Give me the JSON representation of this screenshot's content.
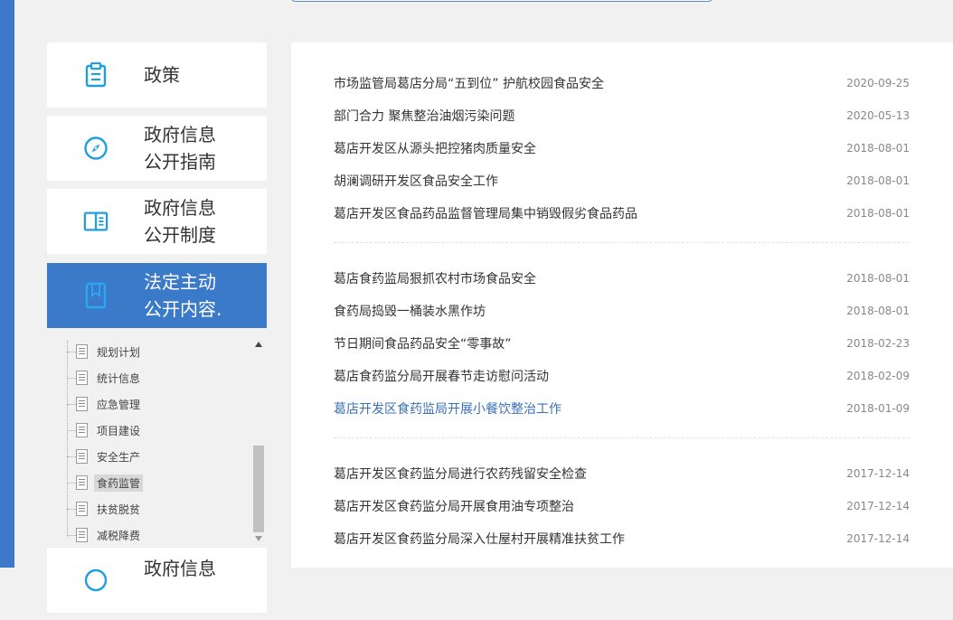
{
  "nav": [
    {
      "label": "政策",
      "icon": "clipboard-icon"
    },
    {
      "label": "政府信息\n公开指南",
      "icon": "compass-icon"
    },
    {
      "label": "政府信息\n公开制度",
      "icon": "book-open-icon"
    },
    {
      "label": "法定主动\n公开内容.",
      "icon": "bookmark-book-icon",
      "active": true
    },
    {
      "label": "政府信息",
      "icon": "info-icon"
    }
  ],
  "tree": {
    "items": [
      "规划计划",
      "统计信息",
      "应急管理",
      "项目建设",
      "安全生产",
      "食药监管",
      "扶贫脱贫",
      "减税降费"
    ],
    "selected": "食药监管"
  },
  "news": {
    "groups": [
      [
        {
          "title": "市场监管局葛店分局“五到位” 护航校园食品安全",
          "date": "2020-09-25"
        },
        {
          "title": "部门合力 聚焦整治油烟污染问题",
          "date": "2020-05-13"
        },
        {
          "title": "葛店开发区从源头把控猪肉质量安全",
          "date": "2018-08-01"
        },
        {
          "title": "胡澜调研开发区食品安全工作",
          "date": "2018-08-01"
        },
        {
          "title": "葛店开发区食品药品监督管理局集中销毁假劣食品药品",
          "date": "2018-08-01"
        }
      ],
      [
        {
          "title": "葛店食药监局狠抓农村市场食品安全",
          "date": "2018-08-01"
        },
        {
          "title": "食药局捣毁一桶装水黑作坊",
          "date": "2018-08-01"
        },
        {
          "title": "节日期间食品药品安全“零事故”",
          "date": "2018-02-23"
        },
        {
          "title": "葛店食药监分局开展春节走访慰问活动",
          "date": "2018-02-09"
        },
        {
          "title": "葛店开发区食药监局开展小餐饮整治工作",
          "date": "2018-01-09",
          "hover": true
        }
      ],
      [
        {
          "title": "葛店开发区食药监分局进行农药残留安全检查",
          "date": "2017-12-14"
        },
        {
          "title": "葛店开发区食药监分局开展食用油专项整治",
          "date": "2017-12-14"
        },
        {
          "title": "葛店开发区食药监分局深入仕屋村开展精准扶贫工作",
          "date": "2017-12-14"
        }
      ]
    ]
  },
  "colors": {
    "accent": "#3b79c9",
    "link_hover": "#3a6fb8",
    "icon_blue": "#1f9ee0"
  }
}
